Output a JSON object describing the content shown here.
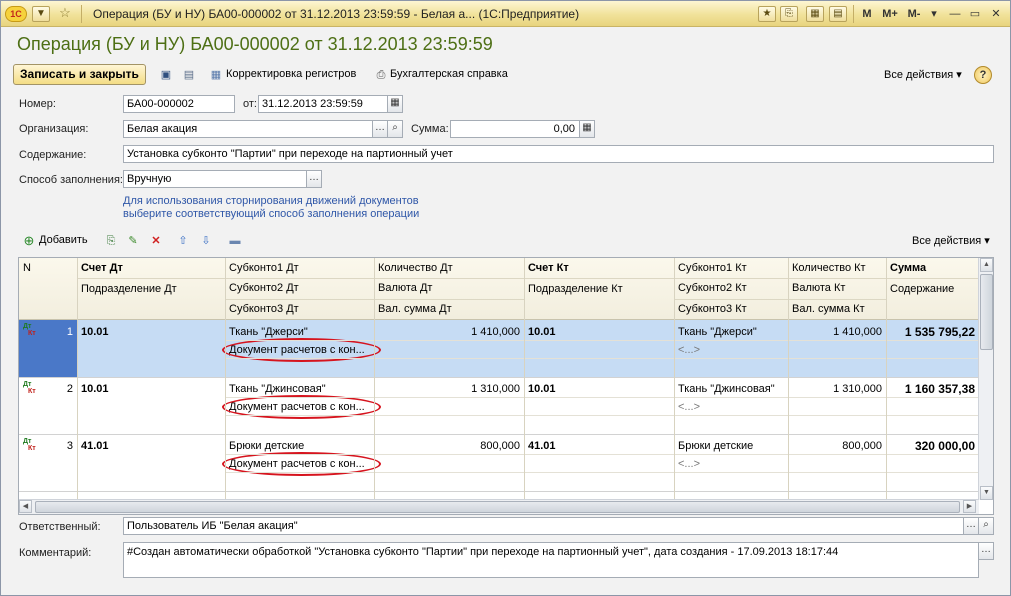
{
  "titlebar": {
    "logo_text": "1С",
    "title": "Операция (БУ и НУ) БА00-000002 от 31.12.2013 23:59:59 - Белая а... (1С:Предприятие)",
    "m_label": "M",
    "mplus_label": "M+",
    "mminus_label": "M-",
    "menu_label": "▾",
    "minimize_label": "—",
    "maximize_label": "▭",
    "close_label": "✕"
  },
  "document": {
    "title": "Операция (БУ и НУ) БА00-000002 от 31.12.2013 23:59:59"
  },
  "toolbar": {
    "save_close_label": "Записать и закрыть",
    "corrections_label": "Корректировка регистров",
    "report_label": "Бухгалтерская справка",
    "all_actions_label": "Все действия ▾",
    "help_label": "?"
  },
  "form": {
    "number_label": "Номер:",
    "number_value": "БА00-000002",
    "date_label": "от:",
    "date_value": "31.12.2013 23:59:59",
    "org_label": "Организация:",
    "org_value": "Белая акация",
    "sum_label": "Сумма:",
    "sum_value": "0,00",
    "content_label": "Содержание:",
    "content_value": "Установка субконто \"Партии\" при переходе на партионный учет",
    "fill_method_label": "Способ заполнения:",
    "fill_method_value": "Вручную",
    "hint_line1": "Для использования сторнирования движений документов",
    "hint_line2": "выберите соответствующий способ заполнения операции",
    "responsible_label": "Ответственный:",
    "responsible_value": "Пользователь ИБ \"Белая акация\"",
    "comment_label": "Комментарий:",
    "comment_value": "#Создан автоматически обработкой \"Установка субконто \"Партии\" при переходе на партионный учет\", дата создания - 17.09.2013 18:17:44"
  },
  "table_toolbar": {
    "add_label": "Добавить",
    "all_actions_label": "Все действия ▾"
  },
  "grid": {
    "headers": {
      "n": "N",
      "acc_dt": "Счет Дт",
      "dept_dt": "Подразделение Дт",
      "sub1_dt": "Субконто1 Дт",
      "sub2_dt": "Субконто2 Дт",
      "sub3_dt": "Субконто3 Дт",
      "qty_dt": "Количество Дт",
      "cur_dt": "Валюта Дт",
      "cur_sum_dt": "Вал. сумма Дт",
      "acc_kt": "Счет Кт",
      "dept_kt": "Подразделение Кт",
      "sub1_kt": "Субконто1 Кт",
      "sub2_kt": "Субконто2 Кт",
      "sub3_kt": "Субконто3 Кт",
      "qty_kt": "Количество Кт",
      "cur_kt": "Валюта Кт",
      "cur_sum_kt": "Вал. сумма Кт",
      "sum": "Сумма",
      "content": "Содержание"
    },
    "dt_label": "Дт",
    "kt_label": "Кт",
    "rows": [
      {
        "n": "1",
        "acc_dt": "10.01",
        "sub1_dt": "Ткань \"Джерси\"",
        "sub2_dt": "Документ расчетов с кон...",
        "qty_dt": "1 410,000",
        "acc_kt": "10.01",
        "sub1_kt": "Ткань \"Джерси\"",
        "sub2_kt": "<...>",
        "qty_kt": "1 410,000",
        "sum": "1 535 795,22"
      },
      {
        "n": "2",
        "acc_dt": "10.01",
        "sub1_dt": "Ткань \"Джинсовая\"",
        "sub2_dt": "Документ расчетов с кон...",
        "qty_dt": "1 310,000",
        "acc_kt": "10.01",
        "sub1_kt": "Ткань \"Джинсовая\"",
        "sub2_kt": "<...>",
        "qty_kt": "1 310,000",
        "sum": "1 160 357,38"
      },
      {
        "n": "3",
        "acc_dt": "41.01",
        "sub1_dt": "Брюки детские",
        "sub2_dt": "Документ расчетов с кон...",
        "qty_dt": "800,000",
        "acc_kt": "41.01",
        "sub1_kt": "Брюки детские",
        "sub2_kt": "<...>",
        "qty_kt": "800,000",
        "sum": "320 000,00"
      }
    ]
  },
  "colors": {
    "title_green": "#4d6f14",
    "highlight_red": "#d6141e",
    "selected_row": "#c6dcf4",
    "hint_blue": "#2f57a8"
  }
}
